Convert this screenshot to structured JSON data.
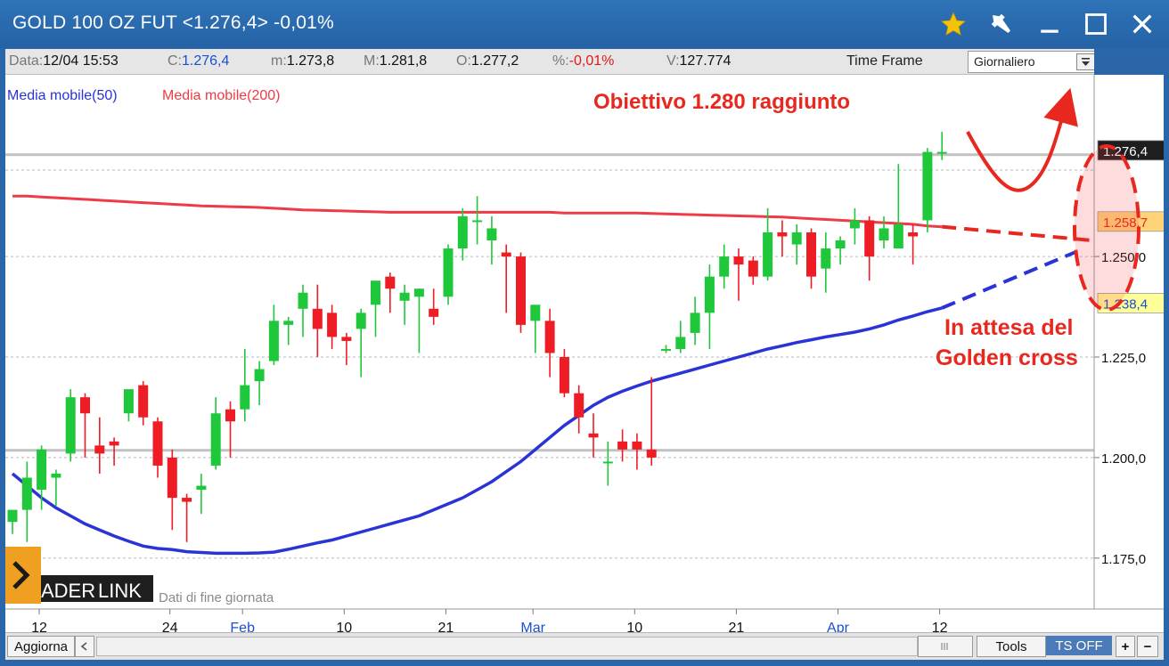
{
  "window": {
    "title": "GOLD 100 OZ FUT <1.276,4> -0,01%"
  },
  "infobar": {
    "date_label": "Data:",
    "date_value": "12/04 15:53",
    "close_label": "C:",
    "close_value": "1.276,4",
    "min_label": "m:",
    "min_value": "1.273,8",
    "max_label": "M:",
    "max_value": "1.281,8",
    "open_label": "O:",
    "open_value": "1.277,2",
    "pct_label": "%:",
    "pct_value": "-0,01%",
    "vol_label": "V:",
    "vol_value": "127.774",
    "timeframe_label": "Time Frame",
    "timeframe_value": "Giornaliero"
  },
  "legend": {
    "ma50": "Media mobile(50)",
    "ma200": "Media mobile(200)"
  },
  "annotations": {
    "target": "Obiettivo 1.280 raggiunto",
    "waiting_line1": "In attesa del",
    "waiting_line2": "Golden cross"
  },
  "branding": {
    "logo_text1": "ADER",
    "logo_text2": "LINK",
    "note": "Dati di fine giornata"
  },
  "bottombar": {
    "refresh": "Aggiorna",
    "tools": "Tools",
    "ts_off": "TS OFF",
    "plus": "+",
    "minus": "−"
  },
  "colors": {
    "bull": "#1fc83a",
    "bear": "#ee1c25",
    "ma50": "#2a34d6",
    "ma200": "#ee3b45",
    "annotation": "#e8271e",
    "ma50_label_bg": "#ffff9a",
    "ma200_label_bg": "#ffd37a",
    "last_label_bg": "#1e1e1e"
  },
  "chart_data": {
    "type": "candlestick",
    "ylim": [
      1165,
      1285
    ],
    "yticks": [
      1175,
      1200,
      1225,
      1250
    ],
    "ytick_labels": [
      "1.175,0",
      "1.200,0",
      "1.225,0",
      "1.250,0"
    ],
    "price_labels": {
      "last": "1.276,4",
      "ma200": "1.258,7",
      "ma50": "1.238,4"
    },
    "price_label_values": {
      "last": 1276.4,
      "ma200": 1258.7,
      "ma50": 1238.4
    },
    "xtick_labels": [
      "12",
      "24",
      "Feb",
      "10",
      "21",
      "Mar",
      "10",
      "21",
      "Apr",
      "12"
    ],
    "xtick_index": [
      0,
      9,
      14,
      21,
      28,
      34,
      41,
      48,
      55,
      62
    ],
    "month_ticks": [
      "Feb",
      "Mar",
      "Apr"
    ],
    "support_levels": [
      1275.3,
      1201.8
    ],
    "candles": [
      {
        "o": 1184,
        "h": 1186,
        "l": 1181,
        "c": 1187
      },
      {
        "o": 1187,
        "h": 1199,
        "l": 1179,
        "c": 1195
      },
      {
        "o": 1192,
        "h": 1203,
        "l": 1187,
        "c": 1202
      },
      {
        "o": 1195,
        "h": 1197,
        "l": 1188,
        "c": 1196
      },
      {
        "o": 1201,
        "h": 1217,
        "l": 1199,
        "c": 1215
      },
      {
        "o": 1215,
        "h": 1216,
        "l": 1200,
        "c": 1211
      },
      {
        "o": 1203,
        "h": 1210,
        "l": 1196,
        "c": 1201
      },
      {
        "o": 1204,
        "h": 1205,
        "l": 1198,
        "c": 1203
      },
      {
        "o": 1211,
        "h": 1216,
        "l": 1209,
        "c": 1217
      },
      {
        "o": 1218,
        "h": 1219,
        "l": 1208,
        "c": 1210
      },
      {
        "o": 1209,
        "h": 1210,
        "l": 1195,
        "c": 1198
      },
      {
        "o": 1200,
        "h": 1202,
        "l": 1182,
        "c": 1190
      },
      {
        "o": 1190,
        "h": 1191,
        "l": 1179,
        "c": 1189
      },
      {
        "o": 1192,
        "h": 1196,
        "l": 1186,
        "c": 1193
      },
      {
        "o": 1198,
        "h": 1215,
        "l": 1197,
        "c": 1211
      },
      {
        "o": 1212,
        "h": 1214,
        "l": 1200,
        "c": 1209
      },
      {
        "o": 1212,
        "h": 1227,
        "l": 1209,
        "c": 1218
      },
      {
        "o": 1219,
        "h": 1224,
        "l": 1213,
        "c": 1222
      },
      {
        "o": 1224,
        "h": 1238,
        "l": 1223,
        "c": 1234
      },
      {
        "o": 1233,
        "h": 1235,
        "l": 1228,
        "c": 1234
      },
      {
        "o": 1237,
        "h": 1243,
        "l": 1230,
        "c": 1241
      },
      {
        "o": 1237,
        "h": 1243,
        "l": 1225,
        "c": 1232
      },
      {
        "o": 1236,
        "h": 1238,
        "l": 1227,
        "c": 1230
      },
      {
        "o": 1230,
        "h": 1231,
        "l": 1223,
        "c": 1229
      },
      {
        "o": 1232,
        "h": 1237,
        "l": 1220,
        "c": 1236
      },
      {
        "o": 1238,
        "h": 1241,
        "l": 1230,
        "c": 1244
      },
      {
        "o": 1245,
        "h": 1246,
        "l": 1236,
        "c": 1242
      },
      {
        "o": 1239,
        "h": 1243,
        "l": 1233,
        "c": 1241
      },
      {
        "o": 1240,
        "h": 1242,
        "l": 1226,
        "c": 1242
      },
      {
        "o": 1237,
        "h": 1242,
        "l": 1233,
        "c": 1235
      },
      {
        "o": 1240,
        "h": 1253,
        "l": 1238,
        "c": 1252
      },
      {
        "o": 1252,
        "h": 1262,
        "l": 1249,
        "c": 1260
      },
      {
        "o": 1259,
        "h": 1265,
        "l": 1253,
        "c": 1259
      },
      {
        "o": 1254,
        "h": 1260,
        "l": 1248,
        "c": 1257
      },
      {
        "o": 1251,
        "h": 1253,
        "l": 1236,
        "c": 1250
      },
      {
        "o": 1250,
        "h": 1251,
        "l": 1231,
        "c": 1233
      },
      {
        "o": 1234,
        "h": 1236,
        "l": 1226,
        "c": 1238
      },
      {
        "o": 1234,
        "h": 1237,
        "l": 1220,
        "c": 1226
      },
      {
        "o": 1225,
        "h": 1227,
        "l": 1215,
        "c": 1216
      },
      {
        "o": 1216,
        "h": 1218,
        "l": 1206,
        "c": 1210
      },
      {
        "o": 1206,
        "h": 1211,
        "l": 1200,
        "c": 1205
      },
      {
        "o": 1199,
        "h": 1204,
        "l": 1193,
        "c": 1199
      },
      {
        "o": 1204,
        "h": 1207,
        "l": 1199,
        "c": 1202
      },
      {
        "o": 1204,
        "h": 1206,
        "l": 1197,
        "c": 1202
      },
      {
        "o": 1202,
        "h": 1220,
        "l": 1198,
        "c": 1200
      },
      {
        "o": 1227,
        "h": 1228,
        "l": 1226,
        "c": 1227
      },
      {
        "o": 1227,
        "h": 1234,
        "l": 1226,
        "c": 1230
      },
      {
        "o": 1231,
        "h": 1240,
        "l": 1228,
        "c": 1236
      },
      {
        "o": 1236,
        "h": 1248,
        "l": 1227,
        "c": 1245
      },
      {
        "o": 1245,
        "h": 1253,
        "l": 1242,
        "c": 1250
      },
      {
        "o": 1250,
        "h": 1252,
        "l": 1239,
        "c": 1248
      },
      {
        "o": 1249,
        "h": 1250,
        "l": 1243,
        "c": 1245
      },
      {
        "o": 1245,
        "h": 1262,
        "l": 1244,
        "c": 1256
      },
      {
        "o": 1256,
        "h": 1259,
        "l": 1250,
        "c": 1255
      },
      {
        "o": 1253,
        "h": 1258,
        "l": 1248,
        "c": 1256
      },
      {
        "o": 1256,
        "h": 1257,
        "l": 1242,
        "c": 1245
      },
      {
        "o": 1247,
        "h": 1256,
        "l": 1241,
        "c": 1252
      },
      {
        "o": 1252,
        "h": 1255,
        "l": 1248,
        "c": 1254
      },
      {
        "o": 1257,
        "h": 1262,
        "l": 1253,
        "c": 1259
      },
      {
        "o": 1259,
        "h": 1260,
        "l": 1244,
        "c": 1250
      },
      {
        "o": 1254,
        "h": 1260,
        "l": 1252,
        "c": 1257
      },
      {
        "o": 1252,
        "h": 1273,
        "l": 1252,
        "c": 1258
      },
      {
        "o": 1256,
        "h": 1258,
        "l": 1248,
        "c": 1255
      },
      {
        "o": 1259,
        "h": 1277,
        "l": 1256,
        "c": 1276
      },
      {
        "o": 1276,
        "h": 1281,
        "l": 1274,
        "c": 1276
      }
    ],
    "series": [
      {
        "name": "Media mobile(200)",
        "values": [
          1265,
          1265,
          1264.8,
          1264.6,
          1264.4,
          1264.2,
          1264,
          1263.8,
          1263.6,
          1263.4,
          1263.2,
          1263,
          1262.8,
          1262.6,
          1262.5,
          1262.4,
          1262.3,
          1262.2,
          1262,
          1261.8,
          1261.6,
          1261.5,
          1261.4,
          1261.3,
          1261.2,
          1261.1,
          1261,
          1261,
          1261,
          1261,
          1261,
          1261,
          1261,
          1261,
          1261,
          1261,
          1261,
          1261,
          1260.8,
          1260.8,
          1260.8,
          1260.8,
          1260.8,
          1260.8,
          1260.7,
          1260.6,
          1260.5,
          1260.4,
          1260.3,
          1260.2,
          1260.1,
          1260,
          1259.9,
          1259.8,
          1259.6,
          1259.4,
          1259.2,
          1259,
          1258.8,
          1258.6,
          1258.4,
          1258.2,
          1258,
          1257.6,
          1257.4
        ]
      },
      {
        "name": "Media mobile(50)",
        "values": [
          1196,
          1193,
          1190,
          1187.5,
          1185.5,
          1183.5,
          1182,
          1180.5,
          1179.2,
          1178,
          1177.4,
          1177.1,
          1176.6,
          1176.4,
          1176.2,
          1176.2,
          1176.2,
          1176.3,
          1176.5,
          1177.2,
          1178,
          1178.8,
          1179.5,
          1180.5,
          1181.5,
          1182.5,
          1183.5,
          1184.5,
          1185.5,
          1187,
          1188.5,
          1190,
          1192,
          1194,
          1196.5,
          1199,
          1202,
          1205,
          1208,
          1210.5,
          1213,
          1215,
          1216.5,
          1217.8,
          1219,
          1220,
          1221,
          1222,
          1223,
          1224,
          1225,
          1226,
          1227,
          1227.8,
          1228.6,
          1229.3,
          1230,
          1230.6,
          1231.2,
          1232,
          1233,
          1234.2,
          1235.2,
          1236.3,
          1237.2
        ]
      }
    ],
    "projections": {
      "ma200_end": 1254,
      "ma50_end": 1251
    }
  }
}
